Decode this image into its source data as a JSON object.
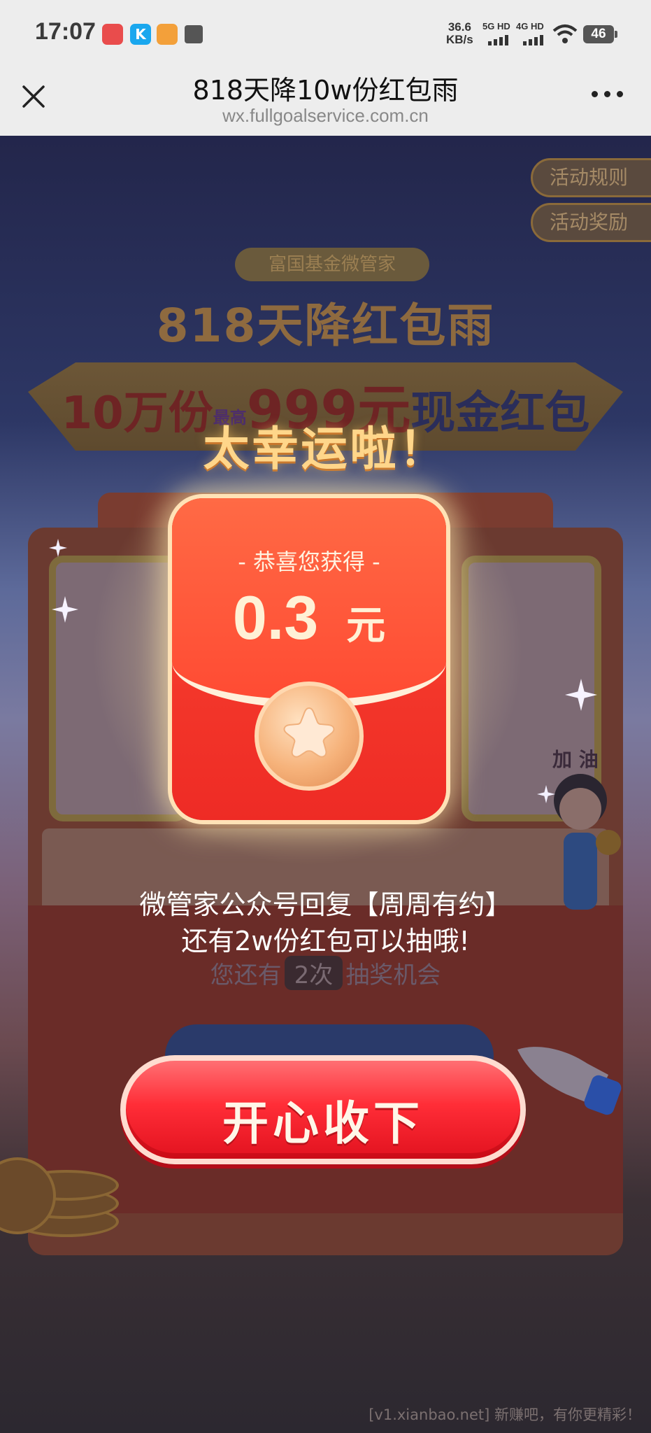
{
  "status_bar": {
    "time": "17:07",
    "app_icon_k": "K",
    "speed_value": "36.6",
    "speed_unit": "KB/s",
    "network_1": "5G HD",
    "network_2": "4G HD",
    "battery": "46"
  },
  "title_bar": {
    "title": "818天降10w份红包雨",
    "url": "wx.fullgoalservice.com.cn"
  },
  "background": {
    "rules_button": "活动规则",
    "reward_button": "活动奖励",
    "brand": "富国基金微管家",
    "headline": "818天降红包雨",
    "ribbon_part1": "10万份",
    "ribbon_small": "最高",
    "ribbon_part2": "999元",
    "ribbon_part3": "现金红包",
    "cheer_label": "加 油"
  },
  "modal": {
    "title": "太幸运啦！",
    "congrats": "- 恭喜您获得 -",
    "amount": "0.3",
    "unit": "元",
    "hint_line1": "微管家公众号回复【周周有约】",
    "hint_line2": "还有2w份红包可以抽哦!",
    "chances_prefix": "您还有",
    "chances_count": "2次",
    "chances_suffix": "抽奖机会",
    "confirm_button": "开心收下"
  },
  "watermark": "[v1.xianbao.net] 新赚吧，有你更精彩！",
  "colors": {
    "accent_red": "#ff2d37",
    "gold": "#ffd68a",
    "status_bg": "#ededed"
  }
}
